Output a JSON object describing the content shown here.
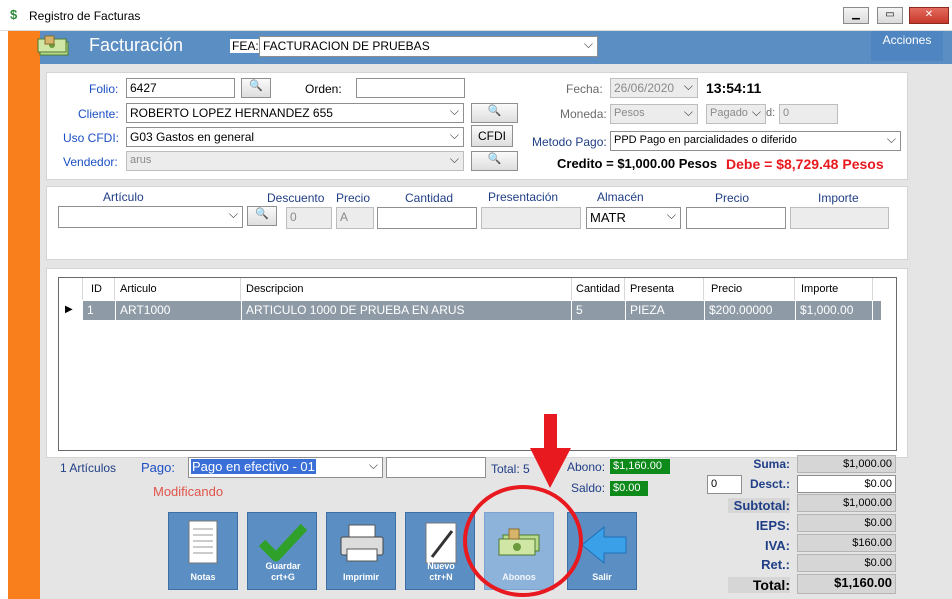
{
  "window": {
    "title": "Registro de Facturas"
  },
  "header": {
    "app_title": "Facturación",
    "fea_label": "FEA:",
    "fea_value": "FACTURACION DE PRUEBAS",
    "actions_label": "Acciones"
  },
  "form": {
    "folio_label": "Folio:",
    "folio_value": "6427",
    "orden_label": "Orden:",
    "orden_value": "",
    "cliente_label": "Cliente:",
    "cliente_value": "ROBERTO LOPEZ HERNANDEZ 655",
    "uso_cfdi_label": "Uso CFDI:",
    "uso_cfdi_value": "G03 Gastos en general",
    "cfdi_button": "CFDI",
    "vendedor_label": "Vendedor:",
    "vendedor_value": "arus",
    "fecha_label": "Fecha:",
    "fecha_value": "26/06/2020",
    "hora_value": "13:54:11",
    "moneda_label": "Moneda:",
    "moneda_value": "Pesos",
    "pagado_value": "Pagado",
    "pagado_suffix": "d:",
    "tipo_cambio_value": "0",
    "metodo_pago_label": "Metodo Pago:",
    "metodo_pago_value": "PPD Pago en parcialidades o diferido",
    "credito_text": "Credito = $1,000.00 Pesos",
    "debe_text": "Debe = $8,729.48 Pesos"
  },
  "article_entry": {
    "articulo_label": "Artículo",
    "descuento_label": "Descuento",
    "descuento_value": "0",
    "precio_label": "Precio",
    "precio_value": "A",
    "cantidad_label": "Cantidad",
    "presentacion_label": "Presentación",
    "almacen_label": "Almacén",
    "almacen_value": "MATR",
    "precio2_label": "Precio",
    "importe_label": "Importe"
  },
  "grid": {
    "columns": [
      "ID",
      "Articulo",
      "Descripcion",
      "Cantidad",
      "Presenta",
      "Precio",
      "Importe"
    ],
    "rows": [
      {
        "id": "1",
        "articulo": "ART1000",
        "descripcion": "ARTICULO 1000 DE PRUEBA EN ARUS",
        "cantidad": "5",
        "presenta": "PIEZA",
        "precio": "$200.00000",
        "importe": "$1,000.00"
      }
    ]
  },
  "footer": {
    "articulos_count": "1 Artículos",
    "pago_label": "Pago:",
    "pago_value": "Pago en efectivo - 01",
    "total_text": "Total: 5",
    "modificando": "Modificando",
    "abono_label": "Abono:",
    "abono_value": "$1,160.00",
    "saldo_label": "Saldo:",
    "saldo_value": "$0.00",
    "desc_input": "0"
  },
  "totals": {
    "suma_label": "Suma:",
    "suma_value": "$1,000.00",
    "desct_label": "Desct.:",
    "desct_value": "$0.00",
    "subtotal_label": "Subtotal:",
    "subtotal_value": "$1,000.00",
    "ieps_label": "IEPS:",
    "ieps_value": "$0.00",
    "iva_label": "IVA:",
    "iva_value": "$160.00",
    "ret_label": "Ret.:",
    "ret_value": "$0.00",
    "total_label": "Total:",
    "total_value": "$1,160.00"
  },
  "actions": {
    "notas": "Notas",
    "guardar": "Guardar crt+G",
    "imprimir": "Imprimir",
    "nuevo": "Nuevo ctr+N",
    "abonos": "Abonos",
    "salir": "Salir"
  },
  "colors": {
    "accent_blue": "#5b8ec3",
    "orange": "#f97f1d",
    "annotation_red": "#e8191f",
    "green_badge": "#0e8a1a"
  }
}
